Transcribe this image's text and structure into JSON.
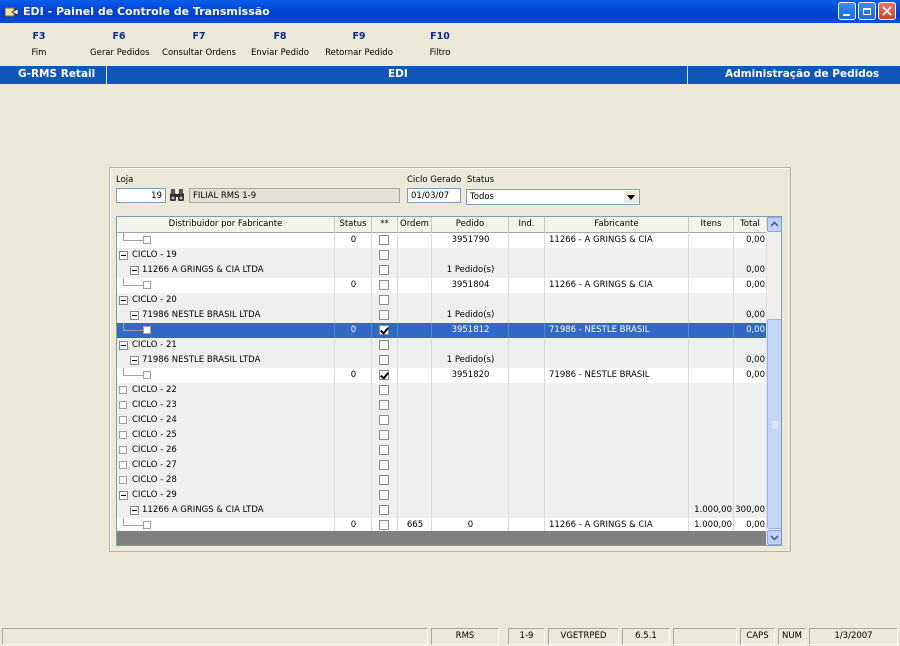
{
  "window": {
    "title": "EDI - Painel de Controle de Transmissão"
  },
  "toolbar": {
    "items": [
      {
        "key": "F3",
        "label": "Fim"
      },
      {
        "key": "F6",
        "label": "Gerar Pedidos"
      },
      {
        "key": "F7",
        "label": "Consultar Ordens"
      },
      {
        "key": "F8",
        "label": "Enviar Pedido"
      },
      {
        "key": "F9",
        "label": "Retornar Pedido"
      },
      {
        "key": "F10",
        "label": "Filtro"
      }
    ]
  },
  "band": {
    "left": "G-RMS Retail",
    "center": "EDI",
    "right": "Administração de Pedidos"
  },
  "filters": {
    "loja_label": "Loja",
    "loja_value": "19",
    "loja_name": "FILIAL RMS 1-9",
    "ciclo_label": "Ciclo Gerado",
    "ciclo_value": "01/03/07",
    "status_label": "Status",
    "status_value": "Todos"
  },
  "grid": {
    "columns": [
      "Distribuidor por Fabricante",
      "Status",
      "**",
      "Ordem",
      "Pedido",
      "Ind.",
      "Fabricante",
      "Itens",
      "Total"
    ],
    "rows": [
      {
        "level": 3,
        "tree": "",
        "status": "0",
        "check": false,
        "ordem": "",
        "pedido": "3951790",
        "ind": "",
        "fabricante": "11266 - A GRINGS & CIA",
        "itens": "",
        "total": "0,00",
        "style": "white"
      },
      {
        "level": 1,
        "tree": "CICLO - 19",
        "status": "",
        "check": false,
        "ordem": "",
        "pedido": "",
        "ind": "",
        "fabricante": "",
        "itens": "",
        "total": "",
        "style": "alt"
      },
      {
        "level": 2,
        "tree": "11266 A GRINGS & CIA LTDA",
        "status": "",
        "check": false,
        "ordem": "",
        "pedido": "1 Pedido(s)",
        "ind": "",
        "fabricante": "",
        "itens": "",
        "total": "0,00",
        "style": "alt"
      },
      {
        "level": 3,
        "tree": "",
        "status": "0",
        "check": false,
        "ordem": "",
        "pedido": "3951804",
        "ind": "",
        "fabricante": "11266 - A GRINGS & CIA",
        "itens": "",
        "total": "0,00",
        "style": "white"
      },
      {
        "level": 1,
        "tree": "CICLO - 20",
        "status": "",
        "check": false,
        "ordem": "",
        "pedido": "",
        "ind": "",
        "fabricante": "",
        "itens": "",
        "total": "",
        "style": "alt"
      },
      {
        "level": 2,
        "tree": "71986 NESTLE BRASIL LTDA",
        "status": "",
        "check": false,
        "ordem": "",
        "pedido": "1 Pedido(s)",
        "ind": "",
        "fabricante": "",
        "itens": "",
        "total": "0,00",
        "style": "alt"
      },
      {
        "level": 3,
        "tree": "",
        "status": "0",
        "check": true,
        "ordem": "",
        "pedido": "3951812",
        "ind": "",
        "fabricante": "71986 - NESTLE BRASIL",
        "itens": "",
        "total": "0,00",
        "style": "sel"
      },
      {
        "level": 1,
        "tree": "CICLO - 21",
        "status": "",
        "check": false,
        "ordem": "",
        "pedido": "",
        "ind": "",
        "fabricante": "",
        "itens": "",
        "total": "",
        "style": "alt"
      },
      {
        "level": 2,
        "tree": "71986 NESTLE BRASIL LTDA",
        "status": "",
        "check": false,
        "ordem": "",
        "pedido": "1 Pedido(s)",
        "ind": "",
        "fabricante": "",
        "itens": "",
        "total": "0,00",
        "style": "alt"
      },
      {
        "level": 3,
        "tree": "",
        "status": "0",
        "check": true,
        "ordem": "",
        "pedido": "3951820",
        "ind": "",
        "fabricante": "71986 - NESTLE BRASIL",
        "itens": "",
        "total": "0,00",
        "style": "white"
      },
      {
        "level": 0,
        "tree": "CICLO - 22",
        "status": "",
        "check": false,
        "ordem": "",
        "pedido": "",
        "ind": "",
        "fabricante": "",
        "itens": "",
        "total": "",
        "style": "alt"
      },
      {
        "level": 0,
        "tree": "CICLO - 23",
        "status": "",
        "check": false,
        "ordem": "",
        "pedido": "",
        "ind": "",
        "fabricante": "",
        "itens": "",
        "total": "",
        "style": "alt"
      },
      {
        "level": 0,
        "tree": "CICLO - 24",
        "status": "",
        "check": false,
        "ordem": "",
        "pedido": "",
        "ind": "",
        "fabricante": "",
        "itens": "",
        "total": "",
        "style": "alt"
      },
      {
        "level": 0,
        "tree": "CICLO - 25",
        "status": "",
        "check": false,
        "ordem": "",
        "pedido": "",
        "ind": "",
        "fabricante": "",
        "itens": "",
        "total": "",
        "style": "alt"
      },
      {
        "level": 0,
        "tree": "CICLO - 26",
        "status": "",
        "check": false,
        "ordem": "",
        "pedido": "",
        "ind": "",
        "fabricante": "",
        "itens": "",
        "total": "",
        "style": "alt"
      },
      {
        "level": 0,
        "tree": "CICLO - 27",
        "status": "",
        "check": false,
        "ordem": "",
        "pedido": "",
        "ind": "",
        "fabricante": "",
        "itens": "",
        "total": "",
        "style": "alt"
      },
      {
        "level": 0,
        "tree": "CICLO - 28",
        "status": "",
        "check": false,
        "ordem": "",
        "pedido": "",
        "ind": "",
        "fabricante": "",
        "itens": "",
        "total": "",
        "style": "alt"
      },
      {
        "level": 1,
        "tree": "CICLO - 29",
        "status": "",
        "check": false,
        "ordem": "",
        "pedido": "",
        "ind": "",
        "fabricante": "",
        "itens": "",
        "total": "",
        "style": "alt"
      },
      {
        "level": 2,
        "tree": "11266 A GRINGS & CIA LTDA",
        "status": "",
        "check": false,
        "ordem": "",
        "pedido": "",
        "ind": "",
        "fabricante": "",
        "itens": "1.000,00",
        "total": "300,00",
        "style": "alt"
      },
      {
        "level": 3,
        "tree": "",
        "status": "0",
        "check": false,
        "ordem": "665",
        "pedido": "0",
        "ind": "",
        "fabricante": "11266 - A GRINGS & CIA",
        "itens": "1.000,00",
        "total": "0,00",
        "style": "white"
      }
    ]
  },
  "statusbar": {
    "panels": [
      "",
      "RMS",
      "1-9",
      "VGETRPED",
      "6.5.1",
      "",
      "CAPS",
      "NUM",
      "1/3/2007"
    ]
  },
  "colors": {
    "band": "#1157b8",
    "selection": "#316ac5",
    "titlebar": "#0046d5"
  }
}
